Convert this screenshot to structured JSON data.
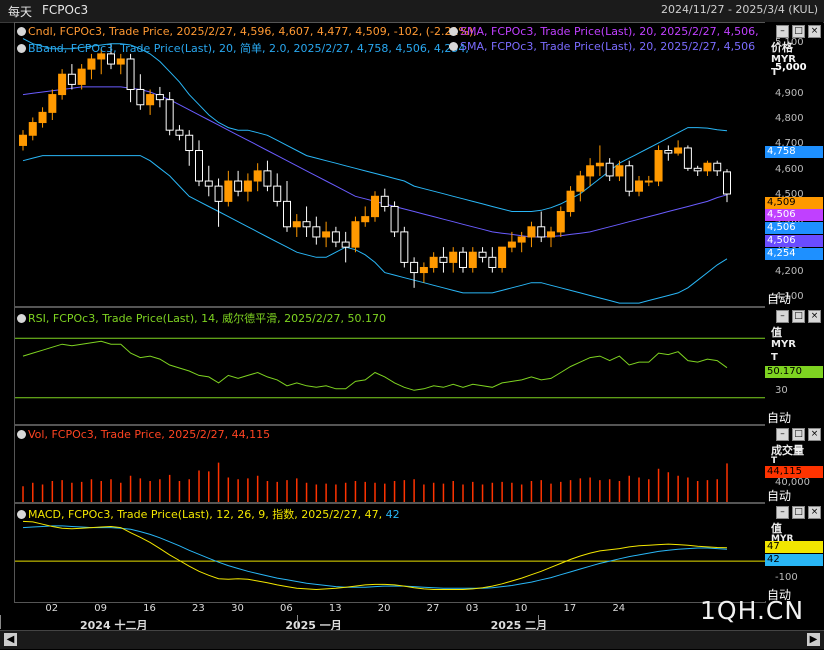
{
  "window": {
    "title": "每天",
    "symbol": "FCPOc3",
    "date_range": "2024/11/27 - 2025/3/4 (KUL)"
  },
  "legends": {
    "candle": "Cndl, FCPOc3, Trade Price, 2025/2/27, 4,596, 4,607, 4,477, 4,509, -102, (-2.21%),",
    "sma1": "SMA, FCPOc3, Trade Price(Last),  20,  2025/2/27, 4,506,",
    "bband": "BBand, FCPOc3, Trade Price(Last),  20, 简单, 2.0,  2025/2/27, 4,758, 4,506, 4,254,",
    "sma2": "SMA, FCPOc3, Trade Price(Last),  20,  2025/2/27, 4,506",
    "rsi": "RSI, FCPOc3, Trade Price(Last),  14, 威尔德平滑, 2025/2/27, 50.170",
    "vol": "Vol, FCPOc3, Trade Price,  2025/2/27, 44,115",
    "macd_prefix": "MACD, FCPOc3, Trade Price(Last),  12, 26, 9, 指数, 2025/2/27, 47, ",
    "macd_signal_value": "42"
  },
  "axes": {
    "price": {
      "unit1": "价格",
      "unit2": "MYR",
      "unit3": "T",
      "ticks": [
        "5,100",
        "5,000",
        "4,900",
        "4,800",
        "4,700",
        "4,600",
        "4,500",
        "4,400",
        "4,300",
        "4,200",
        "4,100"
      ],
      "auto": "自动"
    },
    "rsi": {
      "unit1": "值",
      "unit2": "MYR",
      "unit3": "T",
      "ticks": [
        "30"
      ],
      "auto": "自动"
    },
    "vol": {
      "unit1": "成交量",
      "unit2": "T",
      "ticks": [
        "40,000"
      ],
      "auto": "自动"
    },
    "macd": {
      "unit1": "值",
      "unit2": "MYR",
      "ticks": [
        "-100"
      ],
      "auto": "自动"
    }
  },
  "price_tags": [
    {
      "text": "4,758",
      "color": "#1e90ff"
    },
    {
      "text": "4,509",
      "color": "#ff9900"
    },
    {
      "text": "4,506",
      "color": "#c040ff"
    },
    {
      "text": "4,506",
      "color": "#1e90ff"
    },
    {
      "text": "4,506",
      "color": "#6a4cff"
    },
    {
      "text": "4,254",
      "color": "#1e90ff"
    }
  ],
  "rsi_tag": {
    "text": "50.170",
    "color": "#7ed321"
  },
  "vol_tag": {
    "text": "44,115",
    "color": "#ff3300"
  },
  "macd_tags": [
    {
      "text": "47",
      "color": "#f2e600"
    },
    {
      "text": "42",
      "color": "#29b6f6"
    }
  ],
  "x_axis": {
    "ticks": [
      "02",
      "09",
      "16",
      "23",
      "30",
      "06",
      "13",
      "20",
      "27",
      "03",
      "10",
      "17",
      "24"
    ],
    "months": [
      "2024 十二月",
      "2025 一月",
      "2025 二月"
    ]
  },
  "watermark": "1QH.CN",
  "colors": {
    "up": "#ff9900",
    "down": "#ffffff",
    "bb": "#29b6f6",
    "sma": "#6a5cff",
    "rsi": "#7ed321",
    "vol": "#ff3300",
    "macd": "#f2e600",
    "signal": "#29b6f6"
  },
  "chart_data": {
    "type": "candlestick",
    "candles": [
      [
        4700,
        4760,
        4680,
        4740
      ],
      [
        4740,
        4810,
        4720,
        4790
      ],
      [
        4790,
        4850,
        4770,
        4830
      ],
      [
        4830,
        4920,
        4800,
        4900
      ],
      [
        4900,
        5000,
        4880,
        4980
      ],
      [
        4980,
        5020,
        4920,
        4940
      ],
      [
        4940,
        5020,
        4920,
        5000
      ],
      [
        5000,
        5060,
        4960,
        5040
      ],
      [
        5040,
        5080,
        4980,
        5060
      ],
      [
        5060,
        5100,
        5000,
        5020
      ],
      [
        5020,
        5060,
        4980,
        5040
      ],
      [
        5040,
        5060,
        4870,
        4920
      ],
      [
        4920,
        4980,
        4840,
        4860
      ],
      [
        4860,
        4920,
        4820,
        4900
      ],
      [
        4900,
        4930,
        4850,
        4880
      ],
      [
        4880,
        4910,
        4740,
        4760
      ],
      [
        4760,
        4780,
        4720,
        4740
      ],
      [
        4740,
        4760,
        4620,
        4680
      ],
      [
        4680,
        4720,
        4540,
        4560
      ],
      [
        4560,
        4620,
        4500,
        4540
      ],
      [
        4540,
        4570,
        4380,
        4480
      ],
      [
        4480,
        4600,
        4460,
        4560
      ],
      [
        4560,
        4600,
        4500,
        4520
      ],
      [
        4520,
        4590,
        4480,
        4560
      ],
      [
        4560,
        4630,
        4520,
        4600
      ],
      [
        4600,
        4640,
        4520,
        4540
      ],
      [
        4540,
        4590,
        4460,
        4480
      ],
      [
        4480,
        4560,
        4360,
        4380
      ],
      [
        4380,
        4430,
        4340,
        4400
      ],
      [
        4400,
        4460,
        4340,
        4380
      ],
      [
        4380,
        4420,
        4310,
        4340
      ],
      [
        4340,
        4400,
        4300,
        4360
      ],
      [
        4360,
        4380,
        4300,
        4320
      ],
      [
        4320,
        4360,
        4240,
        4300
      ],
      [
        4300,
        4420,
        4280,
        4400
      ],
      [
        4400,
        4460,
        4380,
        4420
      ],
      [
        4420,
        4520,
        4400,
        4500
      ],
      [
        4500,
        4530,
        4440,
        4460
      ],
      [
        4460,
        4480,
        4340,
        4360
      ],
      [
        4360,
        4380,
        4220,
        4240
      ],
      [
        4240,
        4260,
        4140,
        4200
      ],
      [
        4200,
        4240,
        4160,
        4220
      ],
      [
        4220,
        4280,
        4200,
        4260
      ],
      [
        4260,
        4300,
        4200,
        4240
      ],
      [
        4240,
        4300,
        4200,
        4280
      ],
      [
        4280,
        4300,
        4200,
        4220
      ],
      [
        4220,
        4300,
        4200,
        4280
      ],
      [
        4280,
        4300,
        4240,
        4260
      ],
      [
        4260,
        4300,
        4200,
        4220
      ],
      [
        4220,
        4300,
        4200,
        4300
      ],
      [
        4300,
        4360,
        4280,
        4320
      ],
      [
        4320,
        4360,
        4280,
        4340
      ],
      [
        4340,
        4400,
        4300,
        4380
      ],
      [
        4380,
        4440,
        4320,
        4340
      ],
      [
        4340,
        4380,
        4300,
        4360
      ],
      [
        4360,
        4460,
        4340,
        4440
      ],
      [
        4440,
        4540,
        4420,
        4520
      ],
      [
        4520,
        4600,
        4480,
        4580
      ],
      [
        4580,
        4650,
        4540,
        4620
      ],
      [
        4620,
        4700,
        4580,
        4630
      ],
      [
        4630,
        4650,
        4560,
        4580
      ],
      [
        4580,
        4640,
        4560,
        4620
      ],
      [
        4620,
        4640,
        4500,
        4520
      ],
      [
        4520,
        4580,
        4500,
        4560
      ],
      [
        4560,
        4580,
        4540,
        4560
      ],
      [
        4560,
        4700,
        4540,
        4680
      ],
      [
        4680,
        4700,
        4640,
        4670
      ],
      [
        4670,
        4720,
        4660,
        4690
      ],
      [
        4690,
        4700,
        4600,
        4610
      ],
      [
        4610,
        4620,
        4580,
        4600
      ],
      [
        4600,
        4640,
        4580,
        4630
      ],
      [
        4630,
        4640,
        4580,
        4600
      ],
      [
        4596,
        4607,
        4477,
        4509
      ]
    ],
    "ylim": [
      4100,
      5150
    ],
    "bb_upper": [
      5120,
      5100,
      5090,
      5080,
      5080,
      5080,
      5085,
      5090,
      5095,
      5100,
      5100,
      5095,
      5080,
      5060,
      5030,
      4990,
      4950,
      4900,
      4860,
      4820,
      4790,
      4770,
      4760,
      4760,
      4750,
      4740,
      4720,
      4700,
      4680,
      4660,
      4650,
      4640,
      4630,
      4620,
      4610,
      4600,
      4590,
      4580,
      4570,
      4560,
      4540,
      4530,
      4520,
      4510,
      4500,
      4490,
      4480,
      4470,
      4460,
      4450,
      4440,
      4440,
      4440,
      4445,
      4455,
      4470,
      4490,
      4510,
      4540,
      4570,
      4600,
      4630,
      4650,
      4670,
      4690,
      4710,
      4730,
      4750,
      4770,
      4770,
      4768,
      4762,
      4758
    ],
    "sma": [
      4900,
      4905,
      4910,
      4915,
      4920,
      4925,
      4930,
      4930,
      4930,
      4930,
      4930,
      4925,
      4920,
      4910,
      4895,
      4880,
      4860,
      4840,
      4820,
      4800,
      4780,
      4760,
      4740,
      4720,
      4700,
      4680,
      4660,
      4640,
      4620,
      4600,
      4580,
      4560,
      4540,
      4520,
      4500,
      4490,
      4480,
      4470,
      4460,
      4450,
      4440,
      4430,
      4420,
      4410,
      4400,
      4390,
      4380,
      4370,
      4360,
      4355,
      4350,
      4345,
      4340,
      4340,
      4342,
      4345,
      4350,
      4355,
      4360,
      4370,
      4380,
      4390,
      4400,
      4410,
      4420,
      4430,
      4440,
      4450,
      4460,
      4470,
      4480,
      4495,
      4506
    ],
    "bb_lower": [
      4640,
      4650,
      4660,
      4660,
      4660,
      4660,
      4660,
      4660,
      4660,
      4660,
      4660,
      4660,
      4660,
      4640,
      4610,
      4580,
      4540,
      4500,
      4480,
      4460,
      4440,
      4420,
      4400,
      4380,
      4360,
      4340,
      4320,
      4300,
      4280,
      4270,
      4260,
      4260,
      4280,
      4300,
      4290,
      4270,
      4240,
      4200,
      4190,
      4180,
      4170,
      4160,
      4150,
      4140,
      4130,
      4120,
      4120,
      4120,
      4120,
      4130,
      4140,
      4150,
      4160,
      4160,
      4150,
      4140,
      4130,
      4120,
      4110,
      4100,
      4090,
      4080,
      4080,
      4080,
      4090,
      4100,
      4110,
      4120,
      4140,
      4170,
      4200,
      4230,
      4254
    ],
    "rsi": [
      58,
      60,
      62,
      64,
      66,
      65,
      66,
      67,
      68,
      66,
      66,
      60,
      57,
      58,
      56,
      52,
      50,
      48,
      45,
      44,
      40,
      45,
      43,
      45,
      47,
      44,
      42,
      38,
      40,
      38,
      37,
      38,
      36,
      36,
      41,
      42,
      47,
      44,
      40,
      37,
      35,
      36,
      38,
      37,
      39,
      37,
      39,
      38,
      37,
      40,
      41,
      42,
      44,
      42,
      43,
      47,
      51,
      54,
      57,
      58,
      55,
      58,
      52,
      54,
      54,
      60,
      59,
      61,
      55,
      54,
      56,
      55,
      50.17
    ],
    "rsi_ylim": [
      15,
      85
    ],
    "volume": [
      18,
      22,
      20,
      24,
      25,
      22,
      23,
      26,
      24,
      26,
      22,
      30,
      27,
      24,
      26,
      31,
      24,
      26,
      36,
      35,
      45,
      28,
      26,
      27,
      30,
      24,
      23,
      25,
      27,
      22,
      20,
      21,
      20,
      22,
      24,
      23,
      22,
      21,
      24,
      25,
      26,
      20,
      22,
      21,
      24,
      20,
      23,
      20,
      22,
      23,
      22,
      20,
      24,
      25,
      21,
      23,
      25,
      27,
      28,
      25,
      26,
      24,
      30,
      28,
      26,
      38,
      34,
      30,
      28,
      24,
      25,
      26,
      44.115
    ],
    "vol_ylim": [
      0,
      80
    ],
    "macd": [
      140,
      138,
      130,
      122,
      116,
      114,
      116,
      118,
      120,
      122,
      118,
      100,
      84,
      66,
      44,
      22,
      2,
      -18,
      -36,
      -50,
      -62,
      -64,
      -62,
      -64,
      -70,
      -76,
      -84,
      -90,
      -96,
      -98,
      -100,
      -98,
      -96,
      -92,
      -88,
      -84,
      -82,
      -82,
      -84,
      -88,
      -94,
      -98,
      -100,
      -100,
      -100,
      -100,
      -98,
      -94,
      -88,
      -80,
      -70,
      -60,
      -48,
      -36,
      -22,
      -8,
      6,
      18,
      28,
      36,
      40,
      44,
      50,
      54,
      56,
      58,
      60,
      58,
      56,
      52,
      50,
      48,
      47
    ],
    "signal": [
      118,
      120,
      122,
      124,
      124,
      122,
      120,
      118,
      118,
      118,
      116,
      112,
      104,
      94,
      82,
      68,
      54,
      38,
      24,
      10,
      -4,
      -16,
      -26,
      -36,
      -44,
      -52,
      -60,
      -66,
      -72,
      -78,
      -82,
      -86,
      -90,
      -92,
      -92,
      -92,
      -90,
      -88,
      -88,
      -88,
      -90,
      -92,
      -94,
      -96,
      -96,
      -96,
      -96,
      -96,
      -94,
      -90,
      -86,
      -80,
      -74,
      -66,
      -58,
      -48,
      -38,
      -28,
      -18,
      -8,
      0,
      8,
      16,
      22,
      28,
      34,
      38,
      42,
      44,
      46,
      46,
      44,
      42
    ],
    "macd_ylim": [
      -130,
      180
    ],
    "macd_zero": 0
  }
}
